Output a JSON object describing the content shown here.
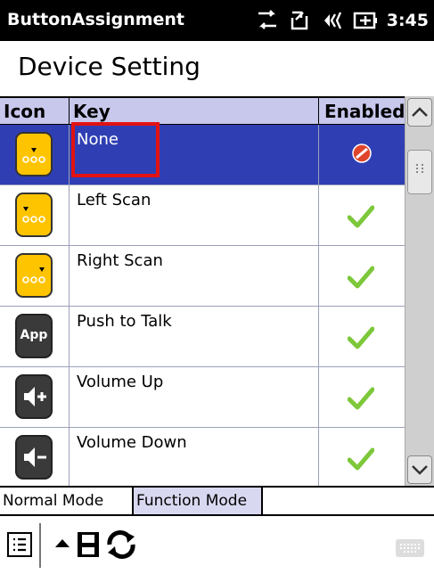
{
  "statusbar": {
    "app_title": "ButtonAssignment",
    "time": "3:45"
  },
  "page": {
    "title": "Device Setting"
  },
  "grid": {
    "columns": [
      "Icon",
      "Key",
      "Enabled"
    ],
    "rows": [
      {
        "key": "None",
        "icon": "yellow-button-icon",
        "icon_color": "#ffc400",
        "enabled": false,
        "selected": true
      },
      {
        "key": "Left Scan",
        "icon": "left-scan-button-icon",
        "icon_color": "#ffc400",
        "enabled": true,
        "selected": false
      },
      {
        "key": "Right Scan",
        "icon": "right-scan-button-icon",
        "icon_color": "#ffc400",
        "enabled": true,
        "selected": false
      },
      {
        "key": "Push to Talk",
        "icon": "app-button-icon",
        "icon_label": "App",
        "icon_color": "#3a3a3a",
        "enabled": true,
        "selected": false
      },
      {
        "key": "Volume Up",
        "icon": "volume-up-icon",
        "icon_color": "#3a3a3a",
        "enabled": true,
        "selected": false
      },
      {
        "key": "Volume Down",
        "icon": "volume-down-icon",
        "icon_color": "#3a3a3a",
        "enabled": true,
        "selected": false
      }
    ]
  },
  "tabs": [
    {
      "label": "Normal Mode",
      "active": true
    },
    {
      "label": "Function Mode",
      "active": false
    }
  ],
  "colors": {
    "selected_row": "#2f3fb3",
    "header_bg": "#c8c8ec",
    "highlight_border": "#e21212",
    "check": "#7dc83a",
    "disabled": "#e0452c"
  }
}
